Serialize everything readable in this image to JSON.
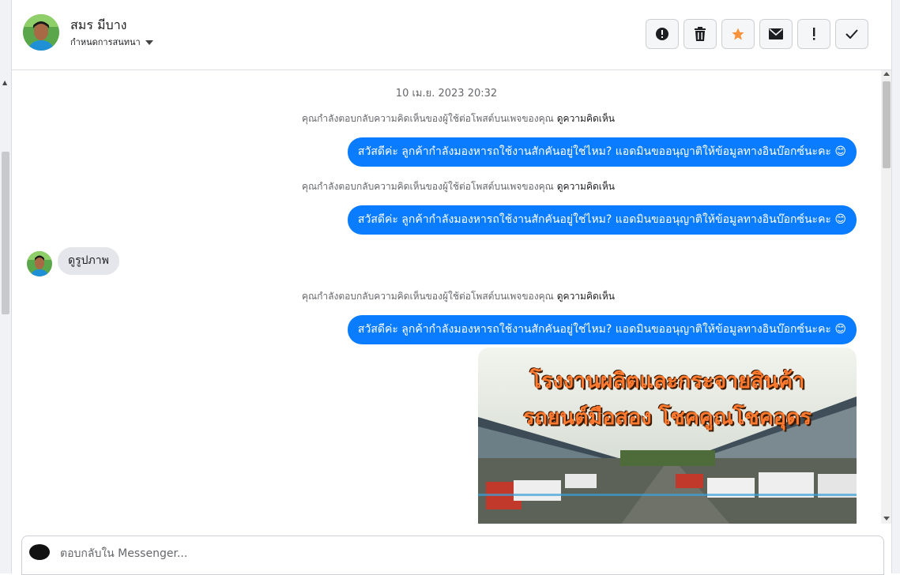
{
  "header": {
    "contact_name": "สมร มีบาง",
    "assign_label": "กำหนดการสนทนา",
    "actions": [
      {
        "name": "mark-spam-button",
        "icon": "alert-circle-icon"
      },
      {
        "name": "delete-button",
        "icon": "trash-icon"
      },
      {
        "name": "star-button",
        "icon": "star-icon",
        "color": "#f7923a"
      },
      {
        "name": "mark-unread-button",
        "icon": "envelope-icon"
      },
      {
        "name": "follow-up-button",
        "icon": "exclamation-icon"
      },
      {
        "name": "mark-done-button",
        "icon": "check-icon"
      }
    ]
  },
  "chat": {
    "timestamp": "10 เม.ย. 2023 20:32",
    "messages": [
      {
        "type": "context",
        "text": "คุณกำลังตอบกลับความคิดเห็นของผู้ใช้ต่อโพสต์บนเพจของคุณ",
        "link": "ดูความคิดเห็น"
      },
      {
        "type": "outgoing",
        "text": "สวัสดีค่ะ ลูกค้ากำลังมองหารถใช้งานสักคันอยู่ใช่ไหม? แอดมินขออนุญาติให้ข้อมูลทางอินบ๊อกซ์นะคะ 😊"
      },
      {
        "type": "context",
        "text": "คุณกำลังตอบกลับความคิดเห็นของผู้ใช้ต่อโพสต์บนเพจของคุณ",
        "link": "ดูความคิดเห็น"
      },
      {
        "type": "outgoing",
        "text": "สวัสดีค่ะ ลูกค้ากำลังมองหารถใช้งานสักคันอยู่ใช่ไหม? แอดมินขออนุญาติให้ข้อมูลทางอินบ๊อกซ์นะคะ 😊"
      },
      {
        "type": "incoming",
        "text": "ดูรูปภาพ"
      },
      {
        "type": "context",
        "text": "คุณกำลังตอบกลับความคิดเห็นของผู้ใช้ต่อโพสต์บนเพจของคุณ",
        "link": "ดูความคิดเห็น"
      },
      {
        "type": "outgoing",
        "text": "สวัสดีค่ะ ลูกค้ากำลังมองหารถใช้งานสักคันอยู่ใช่ไหม? แอดมินขออนุญาติให้ข้อมูลทางอินบ๊อกซ์นะคะ 😊"
      }
    ],
    "image": {
      "line1": "โรงงานผลิตและกระจายสินค้า",
      "line2": "รถยนต์มือสอง โชคคูณโชคอุดร"
    }
  },
  "composer": {
    "placeholder": "ตอบกลับใน Messenger..."
  },
  "colors": {
    "outgoing_bubble": "#0a7cff",
    "incoming_bubble": "#e4e6eb",
    "headline": "#ff7a2e"
  }
}
